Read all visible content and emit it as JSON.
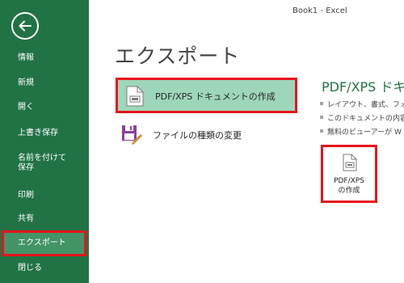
{
  "window": {
    "title": "Book1 - Excel"
  },
  "sidebar": {
    "items": [
      {
        "label": "情報"
      },
      {
        "label": "新規"
      },
      {
        "label": "開く"
      },
      {
        "label": "上書き保存"
      },
      {
        "label": "名前を付けて保存"
      },
      {
        "label": "印刷"
      },
      {
        "label": "共有"
      },
      {
        "label": "エクスポート",
        "selected": true
      },
      {
        "label": "閉じる"
      }
    ],
    "back_icon": "back-arrow-icon"
  },
  "main": {
    "title": "エクスポート",
    "options": [
      {
        "label": "PDF/XPS ドキュメントの作成",
        "icon": "pdf-document-icon",
        "selected": true
      },
      {
        "label": "ファイルの種類の変更",
        "icon": "change-file-type-icon",
        "selected": false
      }
    ]
  },
  "detail": {
    "title": "PDF/XPS ドキ",
    "bullets": [
      "レイアウト、書式、フォ",
      "このドキュメントの内容",
      "無料のビューアーが W"
    ],
    "create_button": {
      "label_line1": "PDF/XPS",
      "label_line2": "の作成",
      "icon": "pdf-document-icon"
    }
  },
  "colors": {
    "sidebar": "#217346",
    "sidebar_selected": "#439467",
    "option_selected": "#9dd6b9",
    "highlight_border": "#e8141c",
    "accent_text": "#217346"
  }
}
